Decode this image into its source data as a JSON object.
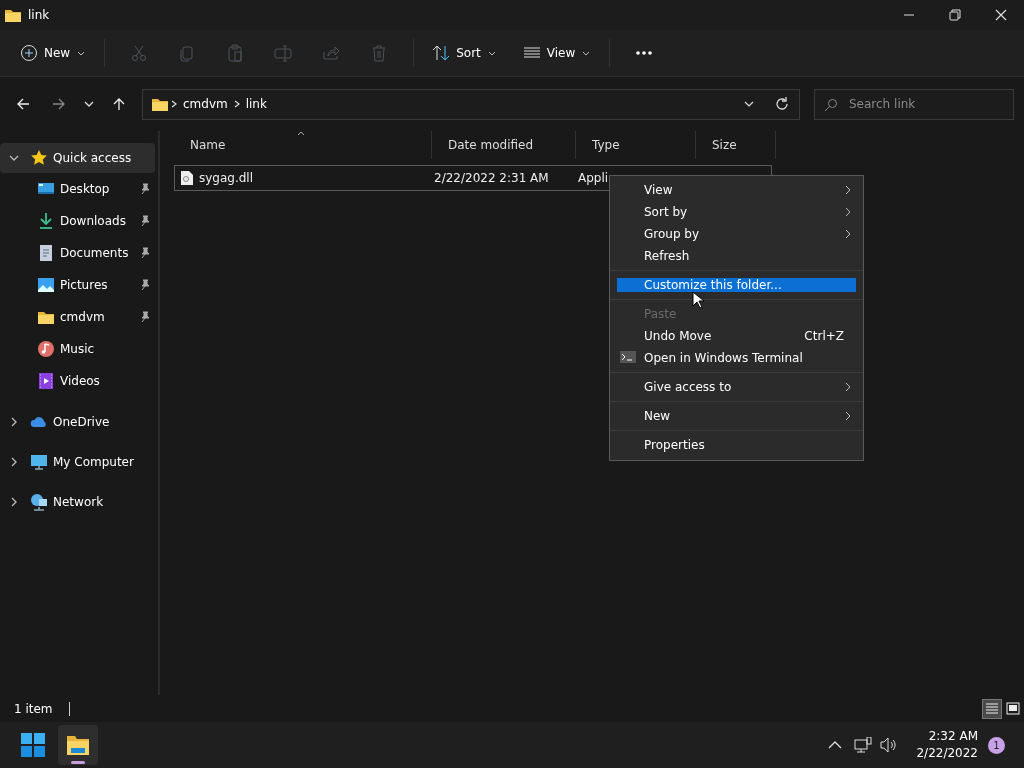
{
  "window": {
    "title": "link"
  },
  "toolbar": {
    "new_label": "New",
    "actions": [
      {
        "kind": "cut",
        "disabled": true
      },
      {
        "kind": "copy",
        "disabled": true
      },
      {
        "kind": "paste",
        "disabled": true
      },
      {
        "kind": "rename",
        "disabled": true
      },
      {
        "kind": "share",
        "disabled": true
      },
      {
        "kind": "delete",
        "disabled": true
      }
    ],
    "sort_label": "Sort",
    "view_label": "View"
  },
  "address_bar": {
    "path": [
      "cmdvm",
      "link"
    ]
  },
  "search": {
    "placeholder": "Search link"
  },
  "sidebar": {
    "items": [
      {
        "label": "Quick access",
        "kind": "star",
        "expanded": true,
        "selected": true,
        "children": [
          {
            "label": "Desktop",
            "kind": "desktop",
            "pinned": true,
            "selected": false
          },
          {
            "label": "Downloads",
            "kind": "download",
            "pinned": true,
            "selected": false
          },
          {
            "label": "Documents",
            "kind": "document",
            "pinned": true,
            "selected": false
          },
          {
            "label": "Pictures",
            "kind": "picture",
            "pinned": true,
            "selected": false
          },
          {
            "label": "cmdvm",
            "kind": "folder",
            "pinned": true,
            "selected": false
          },
          {
            "label": "Music",
            "kind": "music",
            "pinned": false,
            "selected": false
          },
          {
            "label": "Videos",
            "kind": "video",
            "pinned": false,
            "selected": false
          }
        ]
      },
      {
        "label": "OneDrive",
        "kind": "cloud",
        "expanded": false,
        "selected": false
      },
      {
        "label": "My Computer",
        "kind": "computer",
        "expanded": false,
        "selected": false
      },
      {
        "label": "Network",
        "kind": "network",
        "expanded": false,
        "selected": false
      }
    ]
  },
  "columns": [
    {
      "label": "Name",
      "sorted": true
    },
    {
      "label": "Date modified",
      "sorted": false
    },
    {
      "label": "Type",
      "sorted": false
    },
    {
      "label": "Size",
      "sorted": false
    }
  ],
  "files": [
    {
      "name": "sygag.dll",
      "date": "2/22/2022 2:31 AM",
      "type": "Appli",
      "selected": true
    }
  ],
  "context_menu": {
    "items": [
      {
        "kind": "item",
        "label": "View",
        "submenu": true,
        "disabled": false,
        "selected": false
      },
      {
        "kind": "item",
        "label": "Sort by",
        "submenu": true,
        "disabled": false,
        "selected": false
      },
      {
        "kind": "item",
        "label": "Group by",
        "submenu": true,
        "disabled": false,
        "selected": false
      },
      {
        "kind": "item",
        "label": "Refresh",
        "submenu": false,
        "disabled": false,
        "selected": false
      },
      {
        "kind": "separator"
      },
      {
        "kind": "item",
        "label": "Customize this folder...",
        "submenu": false,
        "disabled": false,
        "selected": true
      },
      {
        "kind": "separator"
      },
      {
        "kind": "item",
        "label": "Paste",
        "submenu": false,
        "disabled": true,
        "selected": false
      },
      {
        "kind": "item",
        "label": "Undo Move",
        "shortcut": "Ctrl+Z",
        "submenu": false,
        "disabled": false,
        "selected": false
      },
      {
        "kind": "command",
        "label": "Open in Windows Terminal",
        "submenu": false,
        "disabled": false,
        "selected": false
      },
      {
        "kind": "separator"
      },
      {
        "kind": "item",
        "label": "Give access to",
        "submenu": true,
        "disabled": false,
        "selected": false
      },
      {
        "kind": "separator"
      },
      {
        "kind": "item",
        "label": "New",
        "submenu": true,
        "disabled": false,
        "selected": false
      },
      {
        "kind": "separator"
      },
      {
        "kind": "item",
        "label": "Properties",
        "submenu": false,
        "disabled": false,
        "selected": false
      }
    ]
  },
  "status_bar": {
    "count": "1 item",
    "view_buttons": [
      {
        "kind": "details",
        "selected": true
      },
      {
        "kind": "tiles",
        "selected": false
      }
    ]
  },
  "taskbar": {
    "apps": [
      {
        "kind": "start",
        "running": false
      },
      {
        "kind": "explorer",
        "running": true
      }
    ],
    "time": "2:32 AM",
    "date": "2/22/2022",
    "notification_count": "1"
  }
}
